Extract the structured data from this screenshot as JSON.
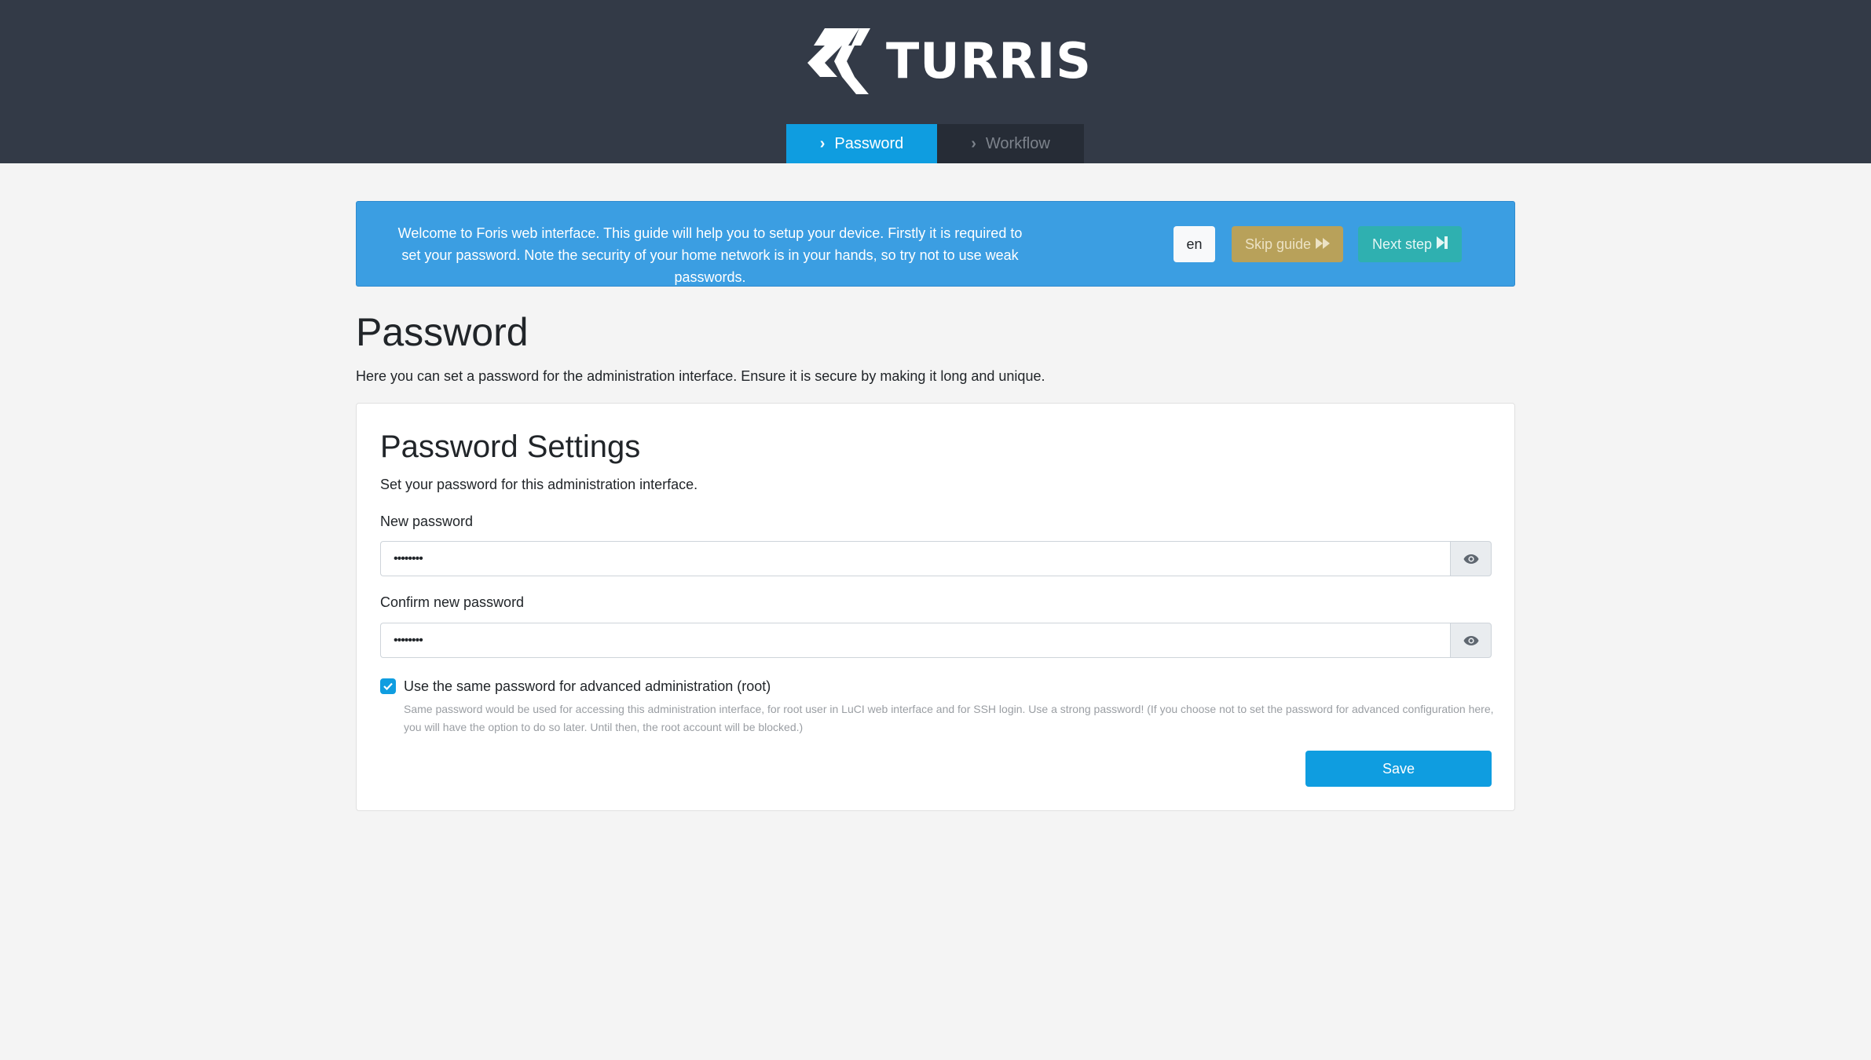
{
  "header": {
    "brand": "TURRIS",
    "tabs": [
      {
        "label": "Password",
        "active": true
      },
      {
        "label": "Workflow",
        "active": false
      }
    ]
  },
  "guide": {
    "message": "Welcome to Foris web interface. This guide will help you to setup your device. Firstly it is required to set your password. Note the security of your home network is in your hands, so try not to use weak passwords.",
    "language": "en",
    "skip_label": "Skip guide",
    "next_label": "Next step"
  },
  "page": {
    "title": "Password",
    "description": "Here you can set a password for the administration interface. Ensure it is secure by making it long and unique."
  },
  "settings": {
    "title": "Password Settings",
    "description": "Set your password for this administration interface.",
    "new_password_label": "New password",
    "new_password_value": "••••••••",
    "confirm_password_label": "Confirm new password",
    "confirm_password_value": "••••••••",
    "root_checkbox_label": "Use the same password for advanced administration (root)",
    "root_checkbox_checked": true,
    "root_help": "Same password would be used for accessing this administration interface, for root user in LuCI web interface and for SSH login. Use a strong password! (If you choose not to set the password for advanced configuration here, you will have the option to do so later. Until then, the root account will be blocked.)",
    "save_label": "Save"
  },
  "colors": {
    "header_bg": "#333a47",
    "accent": "#0f9de0",
    "guide_bg": "#3b9ee2",
    "skip_bg": "#b8a15a",
    "next_bg": "#2fb0b0"
  }
}
